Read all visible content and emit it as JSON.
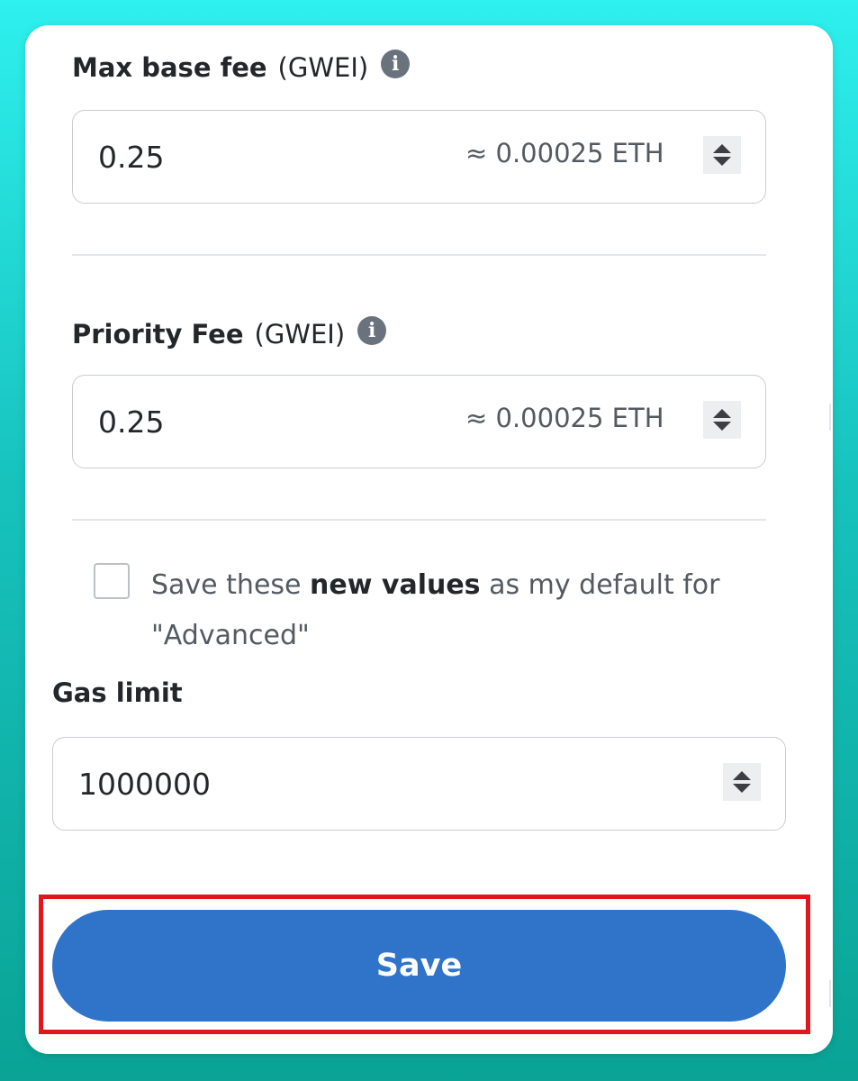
{
  "max_base_fee": {
    "label": "Max base fee",
    "unit": "(GWEI)",
    "value": "0.25",
    "eth_approx": "≈ 0.00025 ETH"
  },
  "priority_fee": {
    "label": "Priority Fee",
    "unit": "(GWEI)",
    "value": "0.25",
    "eth_approx": "≈ 0.00025 ETH"
  },
  "save_default": {
    "checked": false,
    "text_before": "Save these ",
    "text_bold": "new values",
    "text_after": " as my default for",
    "text_line2": "\"Advanced\""
  },
  "gas_limit": {
    "label": "Gas limit",
    "value": "1000000"
  },
  "save_button": {
    "label": "Save"
  },
  "icons": {
    "info": "info-icon",
    "stepper": "stepper-icon"
  },
  "colors": {
    "primary": "#2f74c9",
    "highlight": "#e2141c"
  }
}
